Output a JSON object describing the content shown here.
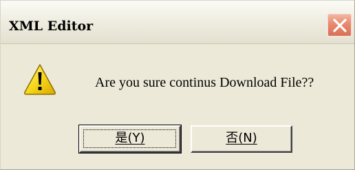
{
  "window": {
    "title": "XML Editor",
    "close_icon": "close-icon"
  },
  "message": {
    "icon": "warning-icon",
    "text": "Are you sure continus Download File??"
  },
  "buttons": {
    "yes_label": "是(Y)",
    "no_label": "否(N)"
  },
  "colors": {
    "dialog_bg": "#ece9d8",
    "close_button": "#e07a5f",
    "warning_yellow": "#f8d81c"
  }
}
